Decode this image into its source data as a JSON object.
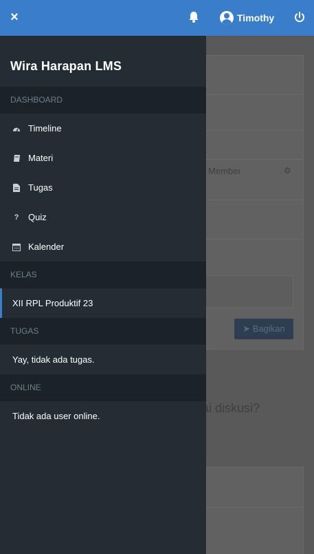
{
  "topbar": {
    "close_glyph": "×",
    "username": "Timothy",
    "icons": [
      "close-icon",
      "bell-icon",
      "user-avatar-icon",
      "power-icon"
    ],
    "accent_color": "#3a7dc9"
  },
  "sidebar": {
    "brand": "Wira Harapan LMS",
    "sections": {
      "dashboard": "DASHBOARD",
      "kelas": "KELAS",
      "tugas": "TUGAS",
      "online": "ONLINE"
    },
    "menu": [
      {
        "label": "Timeline",
        "icon": "dashboard-gauge-icon"
      },
      {
        "label": "Materi",
        "icon": "book-icon"
      },
      {
        "label": "Tugas",
        "icon": "file-icon"
      },
      {
        "label": "Quiz",
        "icon": "question-icon"
      },
      {
        "label": "Kalender",
        "icon": "calendar-icon"
      }
    ],
    "kelas_item": "XII RPL Produktif 23",
    "tugas_info": "Yay, tidak ada tugas.",
    "online_info": "Tidak ada user online."
  },
  "background": {
    "member_label": "Member",
    "share_button": "Bagikan",
    "discussion_fragment": "ai diskusi?"
  }
}
